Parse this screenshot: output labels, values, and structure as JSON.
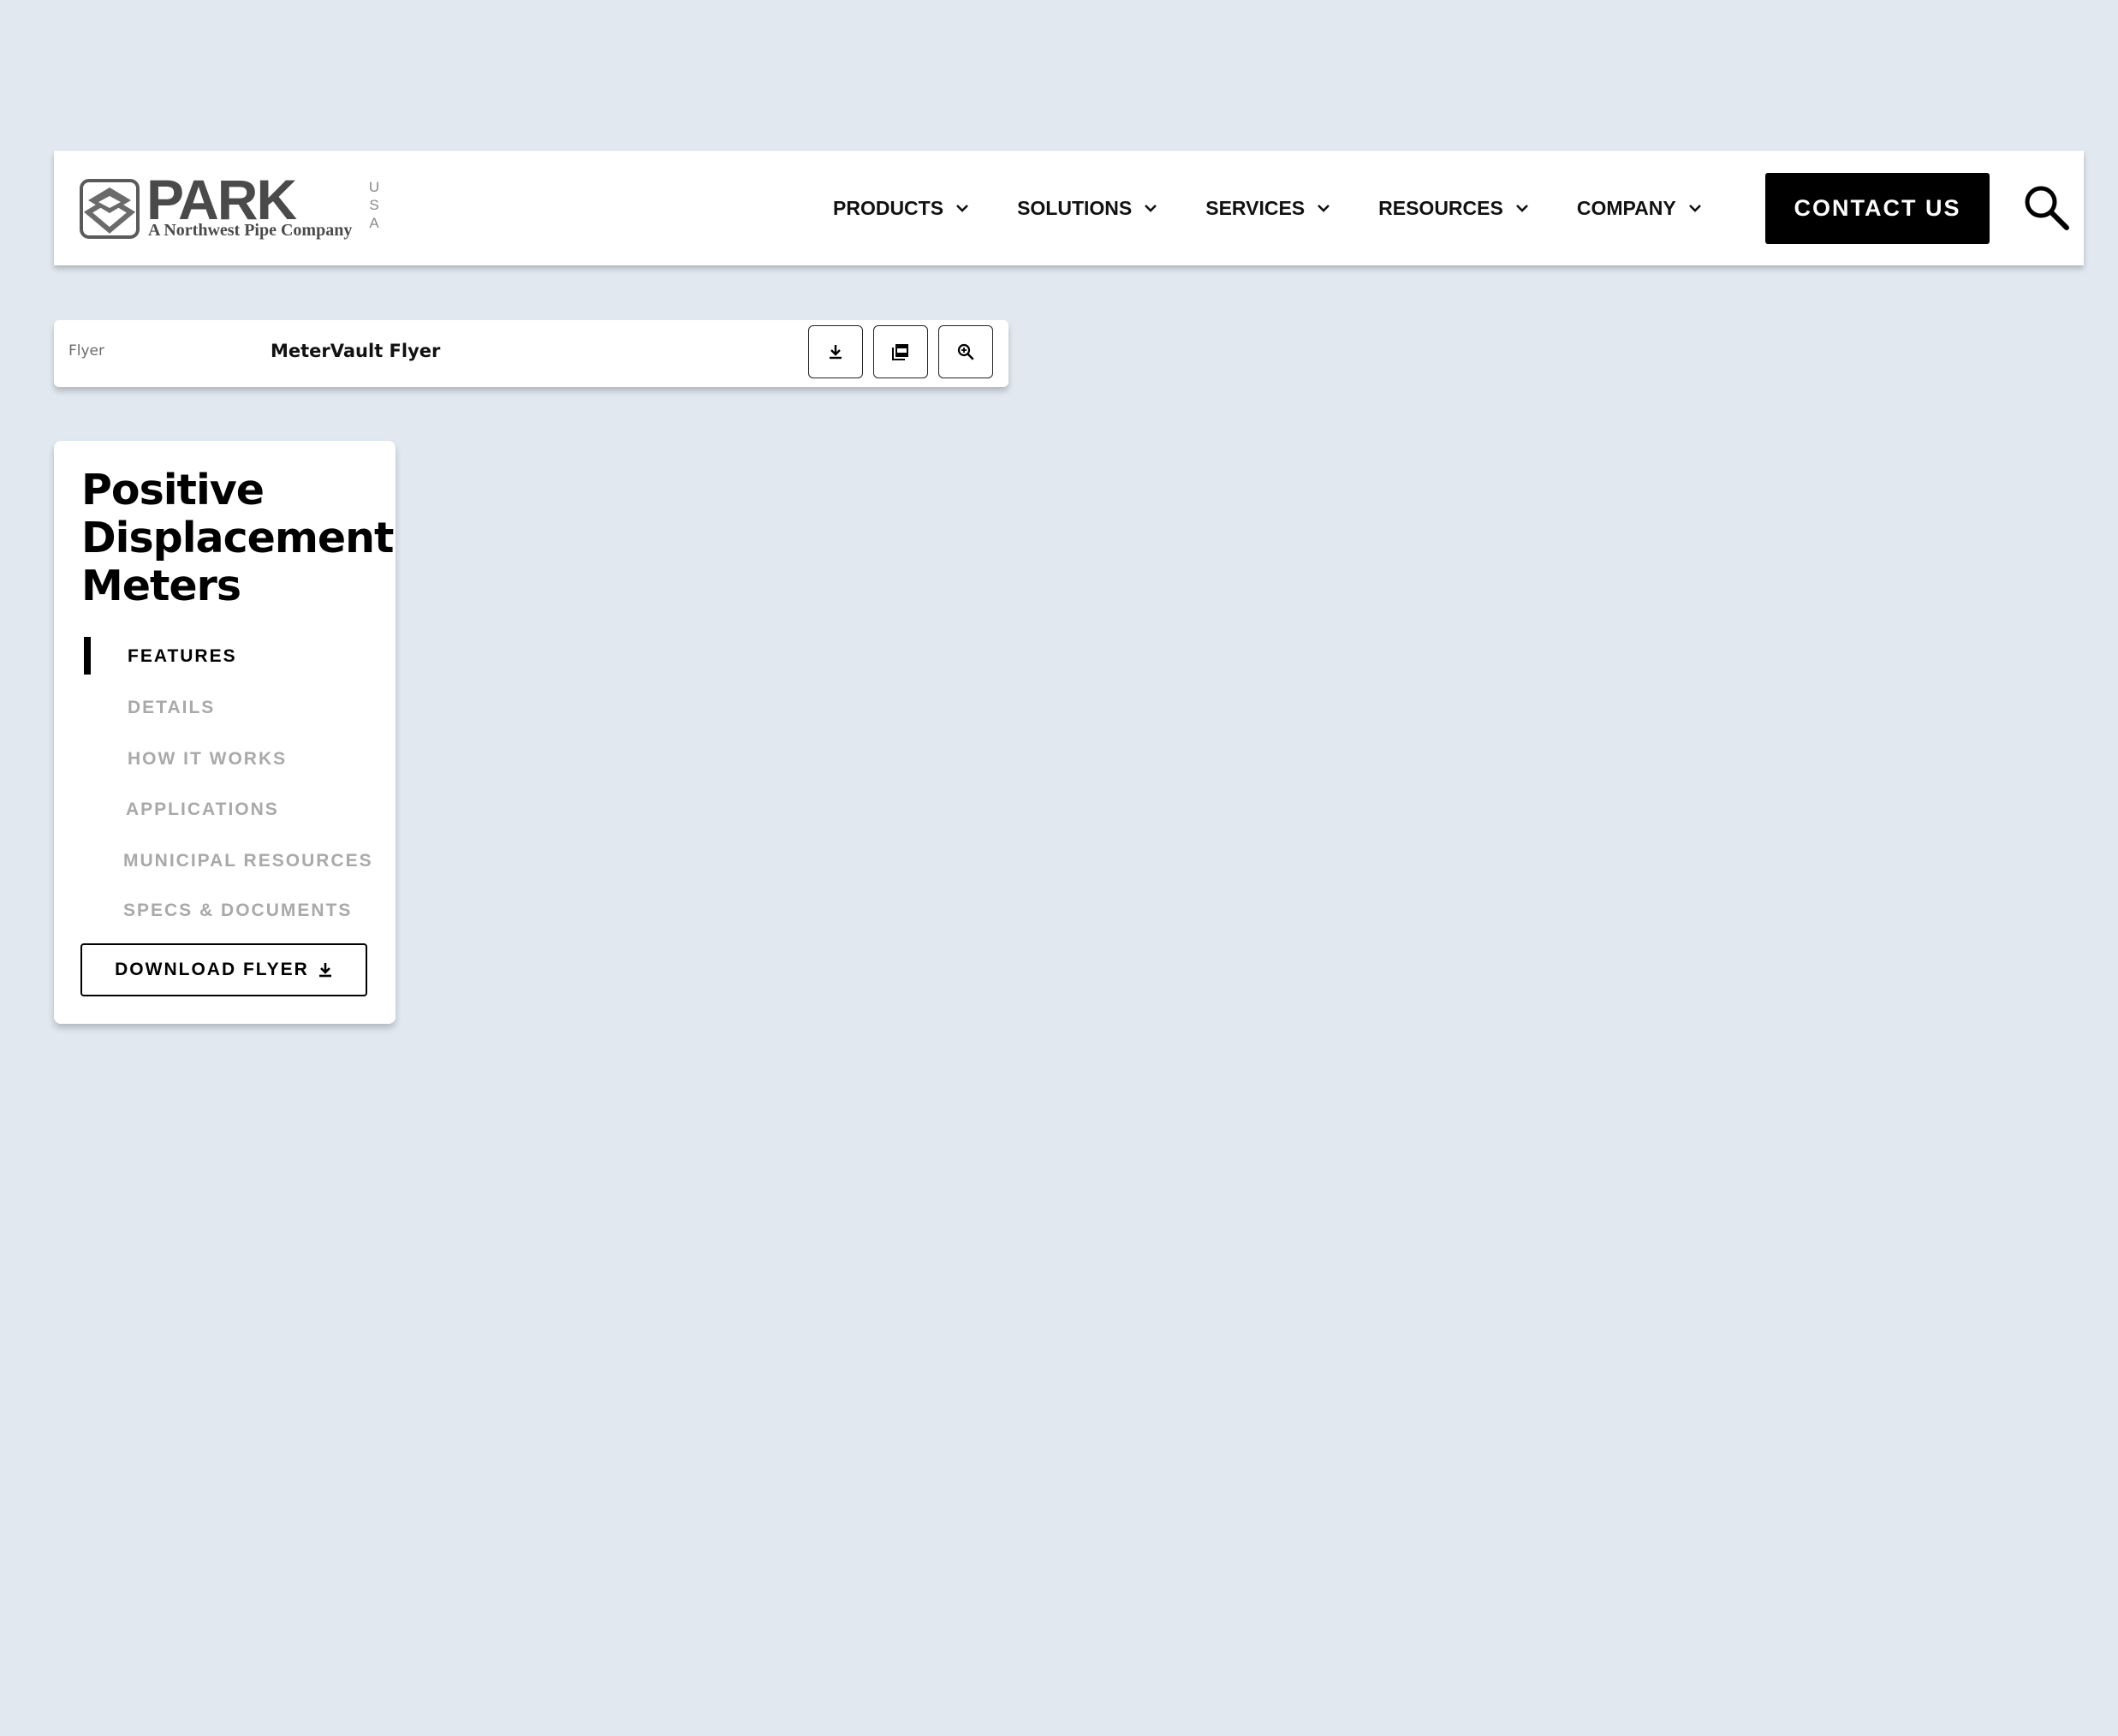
{
  "header": {
    "logo": {
      "word": "PARK",
      "usa": [
        "U",
        "S",
        "A"
      ],
      "tagline": "A Northwest Pipe Company"
    },
    "nav": [
      {
        "label": "PRODUCTS"
      },
      {
        "label": "SOLUTIONS"
      },
      {
        "label": "SERVICES"
      },
      {
        "label": "RESOURCES"
      },
      {
        "label": "COMPANY"
      }
    ],
    "contact_label": "CONTACT US",
    "search_icon": "search-icon"
  },
  "flyer_bar": {
    "type": "Flyer",
    "name": "MeterVault Flyer",
    "actions": [
      "download-icon",
      "pdf-icon",
      "zoom-in-icon"
    ]
  },
  "sidebar": {
    "title_lines": [
      "Positive",
      "Displacement",
      "Meters"
    ],
    "sections": [
      {
        "label": "FEATURES",
        "active": true
      },
      {
        "label": "DETAILS",
        "active": false
      },
      {
        "label": "HOW IT WORKS",
        "active": false
      },
      {
        "label": "APPLICATIONS",
        "active": false
      },
      {
        "label": "MUNICIPAL RESOURCES",
        "active": false
      },
      {
        "label": "SPECS & DOCUMENTS",
        "active": false
      }
    ],
    "download_label": "DOWNLOAD FLYER"
  },
  "colors": {
    "background": "#e1e8f0",
    "accent": "#000000",
    "inactive_text": "#a9a9a9"
  }
}
